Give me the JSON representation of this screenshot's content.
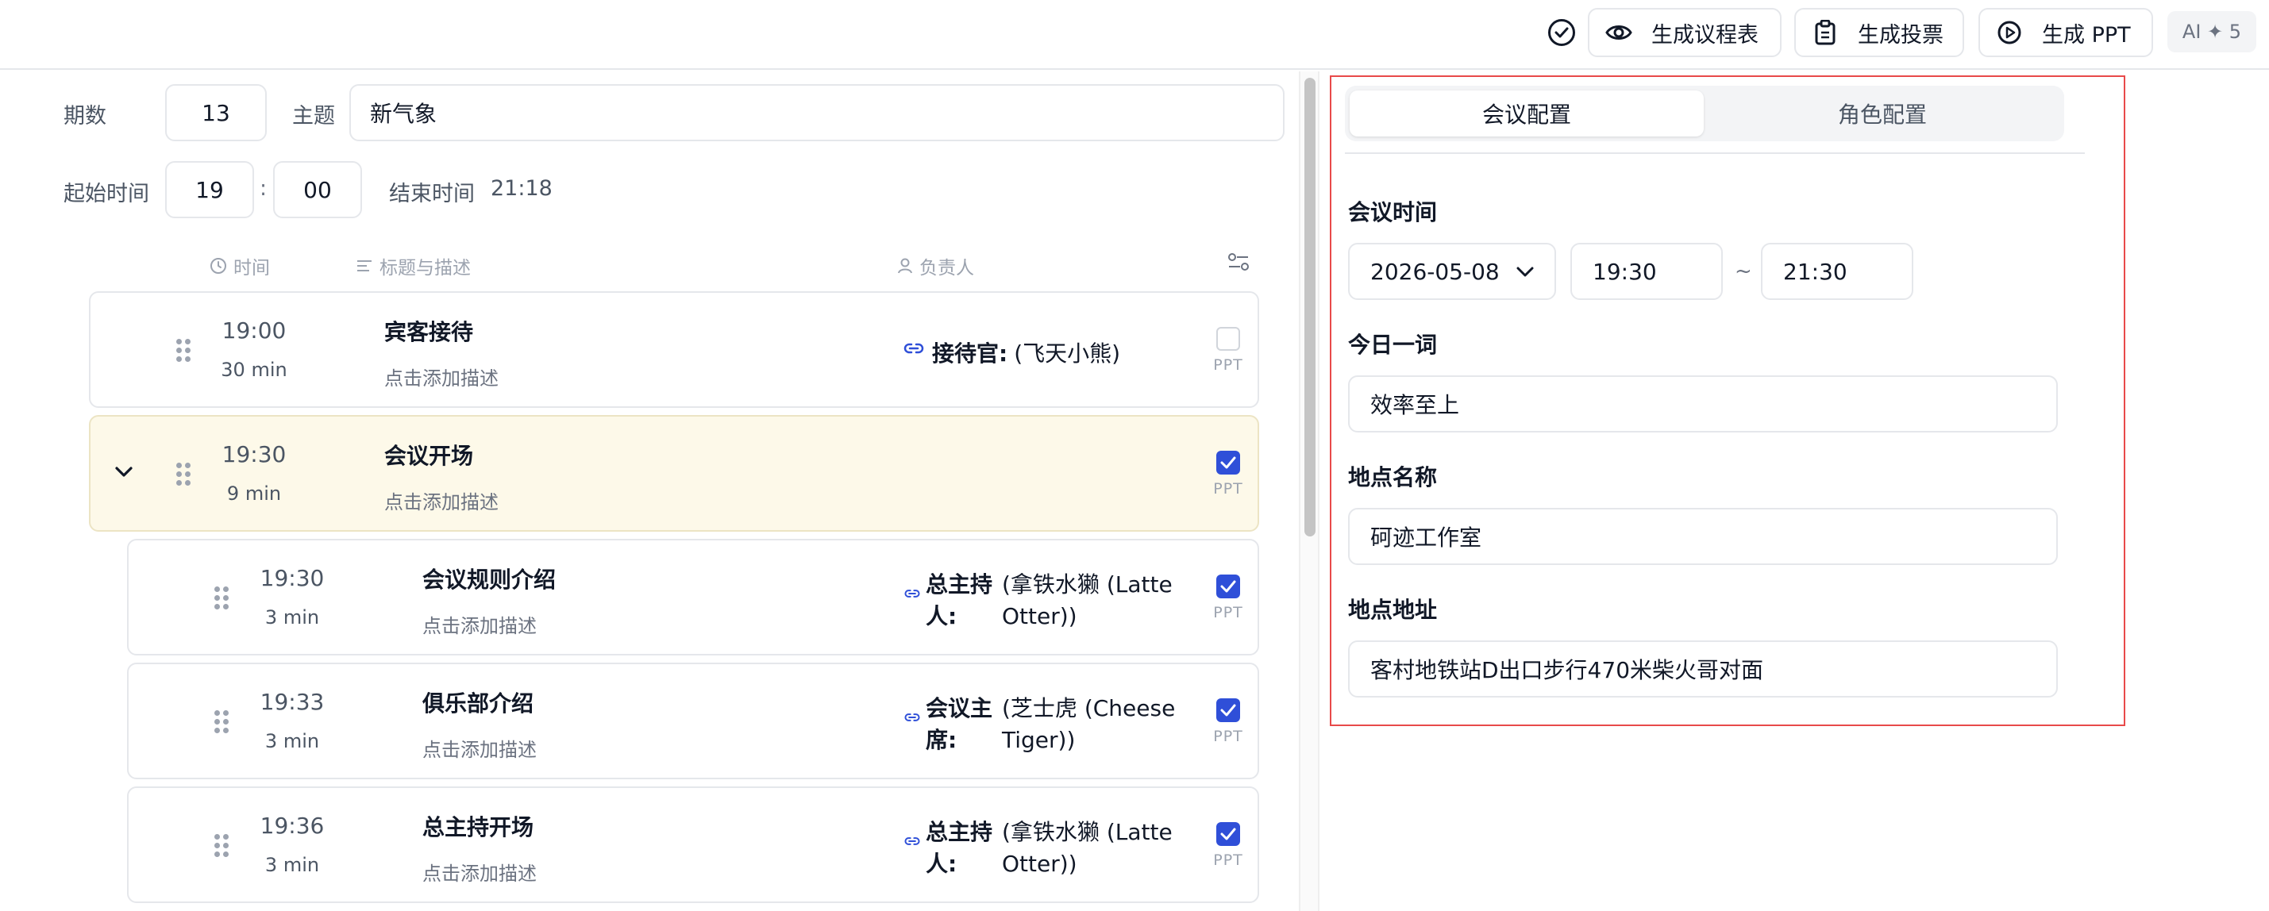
{
  "toolbar": {
    "agenda_label": "生成议程表",
    "vote_label": "生成投票",
    "ppt_label": "生成 PPT",
    "ai_badge": "AI ✦ 5"
  },
  "meeting": {
    "issue_label": "期数",
    "issue_value": "13",
    "theme_label": "主题",
    "theme_value": "新气象",
    "start_label": "起始时间",
    "start_hour": "19",
    "colon": ":",
    "start_minute": "00",
    "end_label": "结束时间",
    "end_value": "21:18"
  },
  "columns": {
    "time": "时间",
    "title": "标题与描述",
    "owner": "负责人"
  },
  "agenda": [
    {
      "time": "19:00",
      "duration": "30 min",
      "title": "宾客接待",
      "desc": "点击添加描述",
      "role": "接待官:",
      "person": "(飞天小熊)",
      "ppt": false,
      "ppt_label": "PPT"
    },
    {
      "time": "19:30",
      "duration": "9 min",
      "title": "会议开场",
      "desc": "点击添加描述",
      "role": "",
      "person": "",
      "ppt": true,
      "ppt_label": "PPT"
    },
    {
      "time": "19:30",
      "duration": "3 min",
      "title": "会议规则介绍",
      "desc": "点击添加描述",
      "role_l1": "总主持",
      "role_l2": "人:",
      "person_l1": "(拿铁水獭 (Latte",
      "person_l2": "Otter))",
      "ppt": true,
      "ppt_label": "PPT"
    },
    {
      "time": "19:33",
      "duration": "3 min",
      "title": "俱乐部介绍",
      "desc": "点击添加描述",
      "role_l1": "会议主",
      "role_l2": "席:",
      "person_l1": "(芝士虎 (Cheese",
      "person_l2": "Tiger))",
      "ppt": true,
      "ppt_label": "PPT"
    },
    {
      "time": "19:36",
      "duration": "3 min",
      "title": "总主持开场",
      "desc": "点击添加描述",
      "role_l1": "总主持",
      "role_l2": "人:",
      "person_l1": "(拿铁水獭 (Latte",
      "person_l2": "Otter))",
      "ppt": true,
      "ppt_label": "PPT"
    }
  ],
  "config": {
    "tab_meeting": "会议配置",
    "tab_roles": "角色配置",
    "time_label": "会议时间",
    "date": "2026-05-08",
    "start": "19:30",
    "tilde": "~",
    "end": "21:30",
    "word_label": "今日一词",
    "word_value": "效率至上",
    "venue_label": "地点名称",
    "venue_value": "砢迹工作室",
    "address_label": "地点地址",
    "address_value": "客村地铁站D出口步行470米柴火哥对面"
  },
  "colors": {
    "accent": "#2f4fd8",
    "highlight_row": "#fdf9e9",
    "focus_outline": "#e84a4a"
  }
}
